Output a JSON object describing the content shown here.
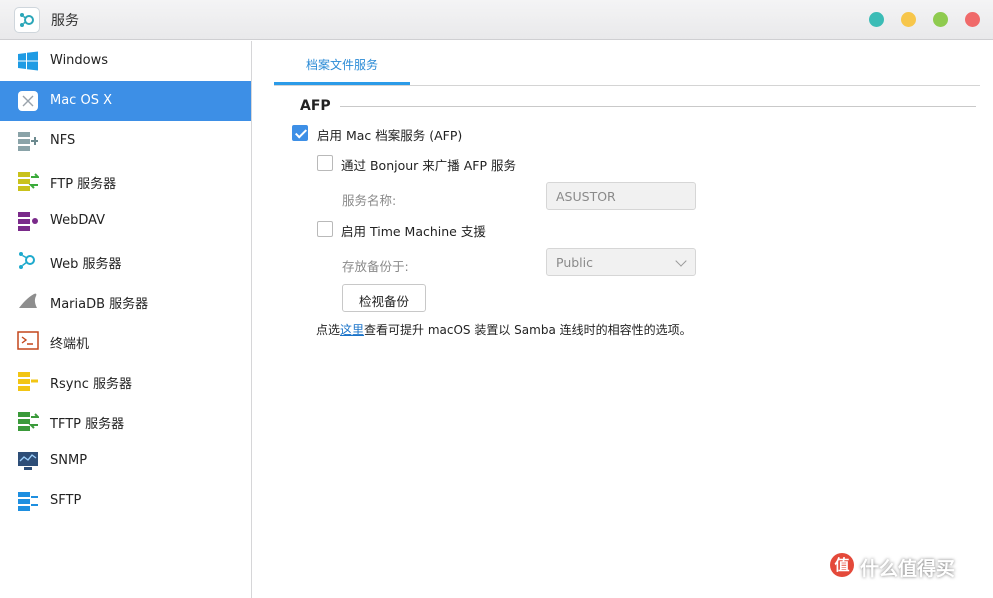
{
  "window": {
    "title": "服务",
    "app_icon": "services-app-icon",
    "controls": [
      {
        "name": "minimize-button",
        "color": "#3bbcb6"
      },
      {
        "name": "restore-button",
        "color": "#f7c64b"
      },
      {
        "name": "maximize-button",
        "color": "#8fcb4f"
      },
      {
        "name": "close-button",
        "color": "#f06a6a"
      }
    ]
  },
  "sidebar": {
    "active_index": 1,
    "items": [
      {
        "label": "Windows",
        "icon": "windows-icon"
      },
      {
        "label": "Mac OS X",
        "icon": "macos-icon"
      },
      {
        "label": "NFS",
        "icon": "nfs-icon"
      },
      {
        "label": "FTP 服务器",
        "icon": "ftp-icon"
      },
      {
        "label": "WebDAV",
        "icon": "webdav-icon"
      },
      {
        "label": "Web 服务器",
        "icon": "web-server-icon"
      },
      {
        "label": "MariaDB 服务器",
        "icon": "mariadb-icon"
      },
      {
        "label": "终端机",
        "icon": "terminal-icon"
      },
      {
        "label": "Rsync 服务器",
        "icon": "rsync-icon"
      },
      {
        "label": "TFTP 服务器",
        "icon": "tftp-icon"
      },
      {
        "label": "SNMP",
        "icon": "snmp-icon"
      },
      {
        "label": "SFTP",
        "icon": "sftp-icon"
      }
    ]
  },
  "main": {
    "tabs": [
      {
        "label": "档案文件服务",
        "active": true
      }
    ],
    "section_title": "AFP",
    "options": {
      "enable_afp": {
        "label": "启用 Mac 档案服务 (AFP)",
        "checked": true
      },
      "bonjour": {
        "label": "通过 Bonjour 来广播 AFP 服务",
        "checked": false
      },
      "service_name": {
        "label": "服务名称:",
        "value": "ASUSTOR"
      },
      "time_machine": {
        "label": "启用 Time Machine 支援",
        "checked": false
      },
      "backup_to": {
        "label": "存放备份于:",
        "value": "Public"
      },
      "check_backup_button": "检视备份"
    },
    "hint": {
      "before": "点选",
      "link": "这里",
      "after": "查看可提升 macOS 装置以 Samba 连线时的相容性的选项。"
    }
  },
  "watermark": {
    "badge": "值",
    "text": "什么值得买"
  },
  "colors": {
    "accent": "#3d8fe6",
    "link": "#1a73c9"
  }
}
